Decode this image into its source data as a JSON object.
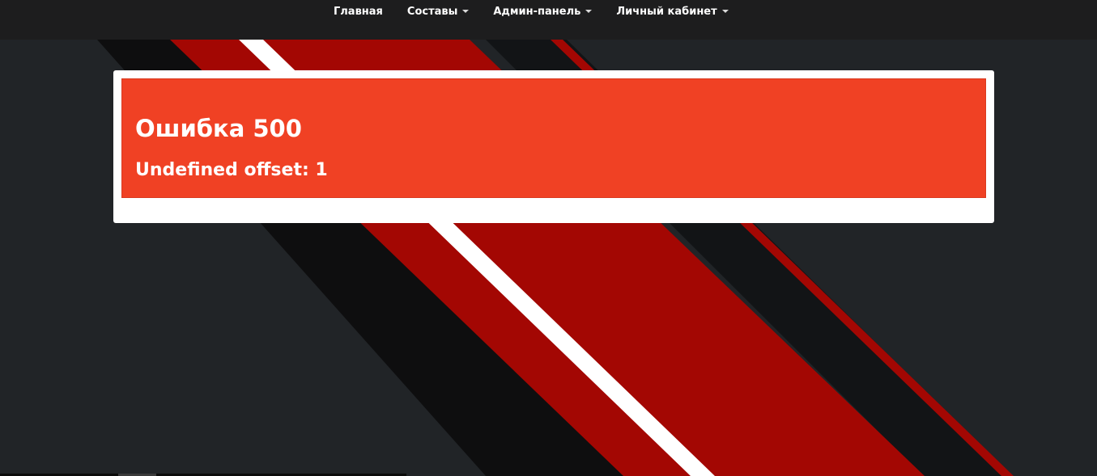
{
  "nav": {
    "items": [
      {
        "label": "Главная",
        "has_dropdown": false
      },
      {
        "label": "Составы",
        "has_dropdown": true
      },
      {
        "label": "Админ-панель",
        "has_dropdown": true
      },
      {
        "label": "Личный кабинет",
        "has_dropdown": true
      }
    ]
  },
  "error": {
    "title": "Ошибка 500",
    "message": "Undefined offset: 1"
  },
  "colors": {
    "navbar_bg": "#1d1d1e",
    "page_bg": "#212427",
    "stripe_red": "#a30703",
    "alert_bg": "#f04124",
    "panel_bg": "#ffffff"
  }
}
